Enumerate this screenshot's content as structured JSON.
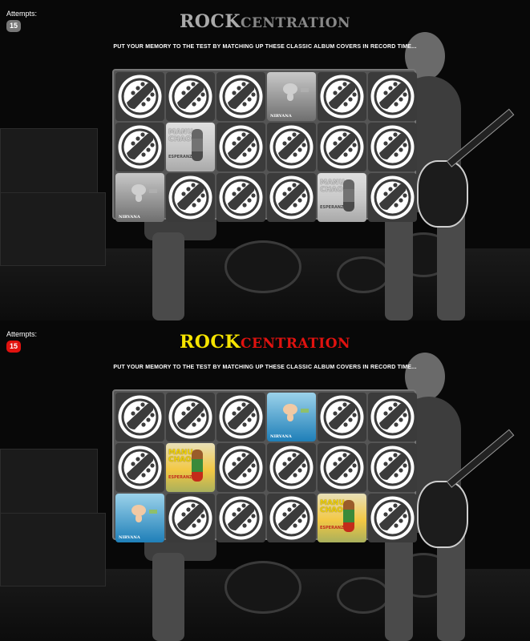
{
  "attempts": {
    "label": "Attempts:",
    "count": "15"
  },
  "title": {
    "part1": "ROCK",
    "part2": "CENTRATION"
  },
  "tagline": "PUT YOUR MEMORY TO THE TEST BY MATCHING UP THESE CLASSIC ALBUM COVERS IN RECORD TIME...",
  "colors": {
    "title_rock_active": "#f6e400",
    "title_centration_active": "#e1120f",
    "attempts_badge_active": "#e1120f",
    "attempts_badge_inactive": "#777777"
  },
  "board": {
    "rows": [
      [
        "back",
        "back",
        "back",
        "nirvana",
        "back",
        "back"
      ],
      [
        "back",
        "manu",
        "back",
        "back",
        "back",
        "back"
      ],
      [
        "nirvana",
        "back",
        "back",
        "back",
        "manu",
        "back"
      ]
    ]
  },
  "covers": {
    "nirvana": {
      "band": "NIRVANA",
      "icon": "nirvana-nevermind-cover"
    },
    "manu": {
      "line1": "MANU",
      "line2": "CHAO",
      "line3": "ESPERANZA",
      "icon": "manu-chao-esperanza-cover"
    },
    "back": {
      "icon": "guitar-headstock-icon"
    }
  },
  "panels": [
    "grayscale",
    "color"
  ]
}
